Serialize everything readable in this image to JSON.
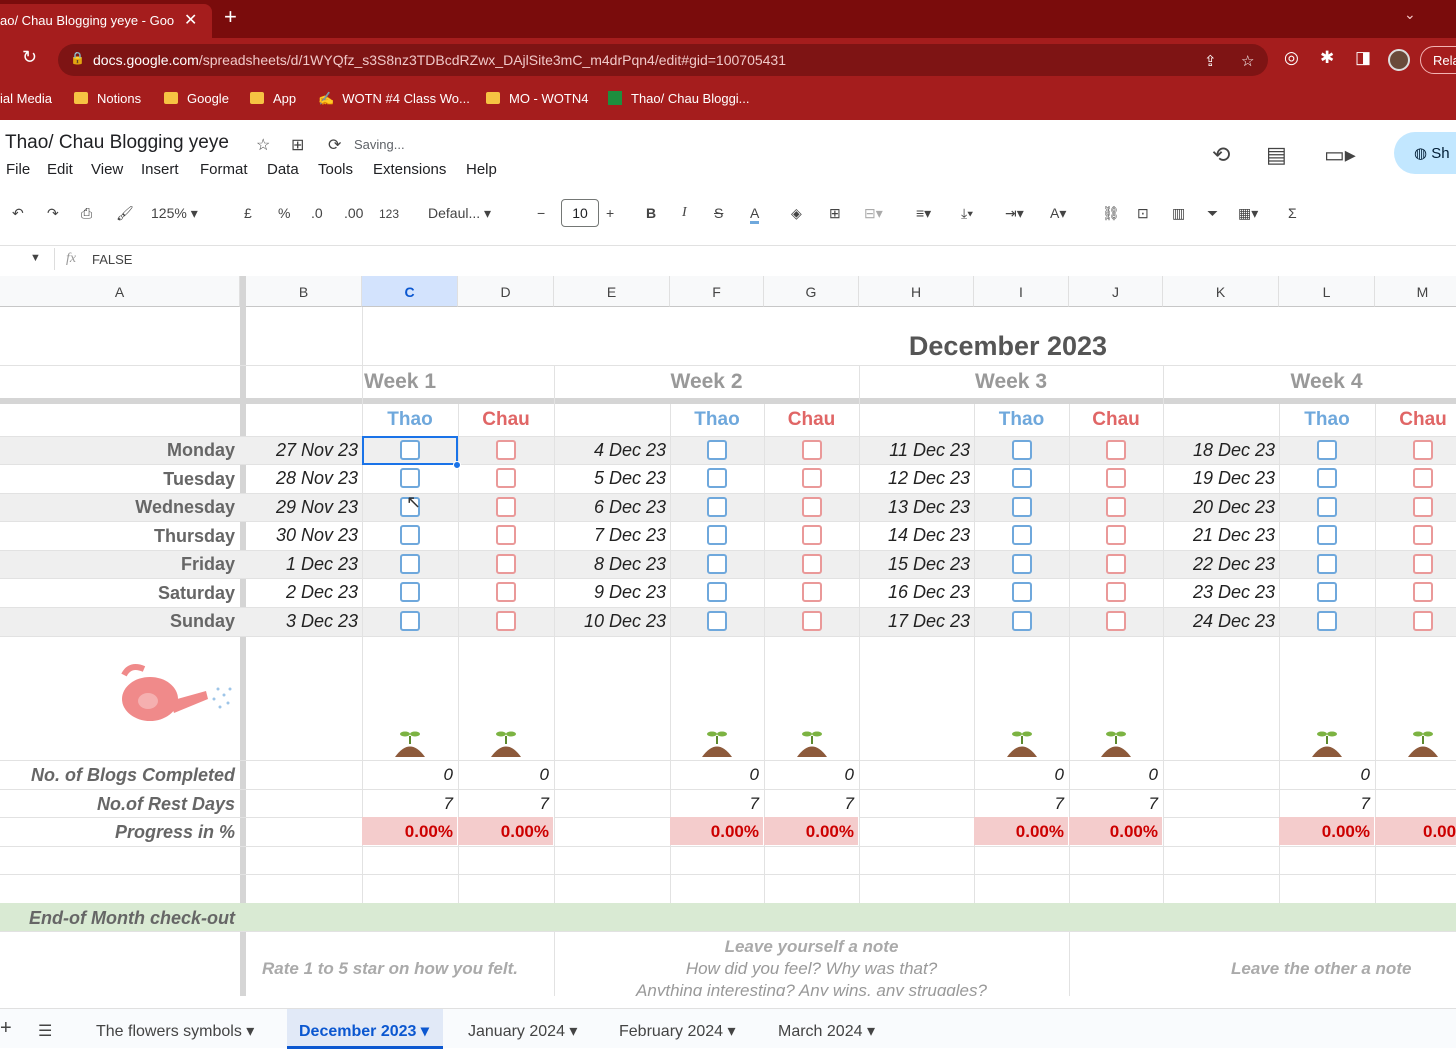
{
  "browser": {
    "tab_title": "ao/ Chau Blogging yeye - Goo",
    "url_host": "docs.google.com",
    "url_path": "/spreadsheets/d/1WYQfz_s3S8nz3TDBcdRZwx_DAjlSite3mC_m4drPqn4/edit#gid=100705431",
    "relaunch_label": "Rela",
    "bookmarks": [
      "ial Media",
      "Notions",
      "Google",
      "App",
      "WOTN #4 Class Wo...",
      "MO - WOTN4",
      "Thao/ Chau Bloggi..."
    ]
  },
  "sheets": {
    "doc_title": "Thao/ Chau Blogging yeye",
    "saving_status": "Saving...",
    "menus": [
      "File",
      "Edit",
      "View",
      "Insert",
      "Format",
      "Data",
      "Tools",
      "Extensions",
      "Help"
    ],
    "share_label": "Sh",
    "toolbar": {
      "zoom": "125%",
      "currency": "£",
      "percent": "%",
      "dec_decrease": ".0",
      "dec_increase": ".00",
      "number_format": "123",
      "font": "Defaul...",
      "font_size": "10"
    },
    "formula_bar": {
      "value": "FALSE"
    },
    "columns": [
      "A",
      "B",
      "C",
      "D",
      "E",
      "F",
      "G",
      "H",
      "I",
      "J",
      "K",
      "L",
      "M"
    ]
  },
  "calendar": {
    "month_title": "December 2023",
    "weeks": [
      "Week 1",
      "Week 2",
      "Week 3",
      "Week 4"
    ],
    "people": [
      "Thao",
      "Chau"
    ],
    "days": [
      "Monday",
      "Tuesday",
      "Wednesday",
      "Thursday",
      "Friday",
      "Saturday",
      "Sunday"
    ],
    "dates": [
      [
        "27 Nov 23",
        "28 Nov 23",
        "29 Nov 23",
        "30 Nov 23",
        "1 Dec 23",
        "2 Dec 23",
        "3 Dec 23"
      ],
      [
        "4 Dec 23",
        "5 Dec 23",
        "6 Dec 23",
        "7 Dec 23",
        "8 Dec 23",
        "9 Dec 23",
        "10 Dec 23"
      ],
      [
        "11 Dec 23",
        "12 Dec 23",
        "13 Dec 23",
        "14 Dec 23",
        "15 Dec 23",
        "16 Dec 23",
        "17 Dec 23"
      ],
      [
        "18 Dec 23",
        "19 Dec 23",
        "20 Dec 23",
        "21 Dec 23",
        "22 Dec 23",
        "23 Dec 23",
        "24 Dec 23"
      ]
    ],
    "stats": {
      "labels": [
        "No. of Blogs Completed",
        "No.of Rest Days",
        "Progress in %"
      ],
      "blogs_completed": [
        "0",
        "0",
        "0",
        "0",
        "0",
        "0",
        "0"
      ],
      "rest_days": [
        "7",
        "7",
        "7",
        "7",
        "7",
        "7",
        "7"
      ],
      "progress": [
        "0.00%",
        "0.00%",
        "0.00%",
        "0.00%",
        "0.00%",
        "0.00%",
        "0.00%",
        "0.00"
      ]
    },
    "checkout": {
      "title": "End-of Month check-out",
      "rate_prompt": "Rate 1 to 5 star on how you felt.",
      "note_title": "Leave yourself a note",
      "note_q1": "How did you feel? Why was that?",
      "note_q2": "Anything interesting? Any wins, any struggles?",
      "other_note": "Leave the other a note"
    }
  },
  "sheet_tabs": [
    "The flowers symbols",
    "December 2023",
    "January 2024",
    "February 2024",
    "March 2024"
  ],
  "colors": {
    "thao": "#6fa8dc",
    "chau": "#e06666",
    "chrome": "#a51d1d",
    "accent": "#0b57d0"
  }
}
